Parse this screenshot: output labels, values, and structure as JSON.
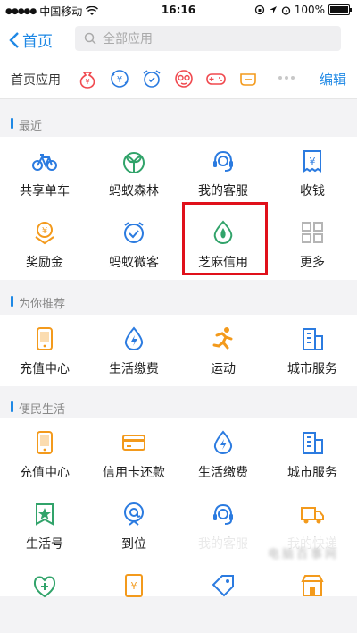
{
  "status_bar": {
    "carrier": "中国移动",
    "time": "16:16",
    "battery": "100%",
    "battery_level": 1.0
  },
  "nav": {
    "back_label": "首页",
    "search_placeholder": "全部应用"
  },
  "quick_bar": {
    "label": "首页应用",
    "edit_label": "编辑",
    "icons": [
      "money-bag-icon",
      "transfer-icon",
      "alarm-icon",
      "glasses-face-icon",
      "gamepad-icon",
      "sofa-icon"
    ]
  },
  "sections": {
    "recent": {
      "title": "最近",
      "items": [
        {
          "label": "共享单车",
          "icon": "bicycle-icon",
          "color": "#2b7be0"
        },
        {
          "label": "蚂蚁森林",
          "icon": "sprout-icon",
          "color": "#31a36a"
        },
        {
          "label": "我的客服",
          "icon": "headset-icon",
          "color": "#2b7be0"
        },
        {
          "label": "收钱",
          "icon": "yuan-receipt-icon",
          "color": "#2b7be0"
        },
        {
          "label": "奖励金",
          "icon": "reward-icon",
          "color": "#f39a1c"
        },
        {
          "label": "蚂蚁微客",
          "icon": "smile-clock-icon",
          "color": "#2b7be0"
        },
        {
          "label": "芝麻信用",
          "icon": "sesame-icon",
          "color": "#31a36a"
        },
        {
          "label": "更多",
          "icon": "grid-icon",
          "color": "#b5b5b5"
        }
      ]
    },
    "recommend": {
      "title": "为你推荐",
      "items": [
        {
          "label": "充值中心",
          "icon": "phone-icon",
          "color": "#f39a1c"
        },
        {
          "label": "生活缴费",
          "icon": "drop-bolt-icon",
          "color": "#2b7be0"
        },
        {
          "label": "运动",
          "icon": "runner-icon",
          "color": "#f39a1c"
        },
        {
          "label": "城市服务",
          "icon": "building-icon",
          "color": "#2b7be0"
        }
      ]
    },
    "life": {
      "title": "便民生活",
      "items": [
        {
          "label": "充值中心",
          "icon": "phone-icon",
          "color": "#f39a1c"
        },
        {
          "label": "信用卡还款",
          "icon": "card-icon",
          "color": "#f39a1c"
        },
        {
          "label": "生活缴费",
          "icon": "drop-bolt-icon",
          "color": "#2b7be0"
        },
        {
          "label": "城市服务",
          "icon": "building-icon",
          "color": "#2b7be0"
        },
        {
          "label": "生活号",
          "icon": "star-badge-icon",
          "color": "#31a36a"
        },
        {
          "label": "到位",
          "icon": "at-location-icon",
          "color": "#2b7be0"
        },
        {
          "label": "我的客服",
          "icon": "headset-icon",
          "color": "#2b7be0"
        },
        {
          "label": "我的快递",
          "icon": "truck-icon",
          "color": "#f39a1c"
        },
        {
          "label": "",
          "icon": "medical-icon",
          "color": "#31a36a"
        },
        {
          "label": "",
          "icon": "yuan-doc-icon",
          "color": "#f39a1c"
        },
        {
          "label": "",
          "icon": "tag-icon",
          "color": "#2b7be0"
        },
        {
          "label": "",
          "icon": "shop-icon",
          "color": "#f39a1c"
        }
      ]
    }
  },
  "watermark": {
    "text": "电脑百事网"
  }
}
